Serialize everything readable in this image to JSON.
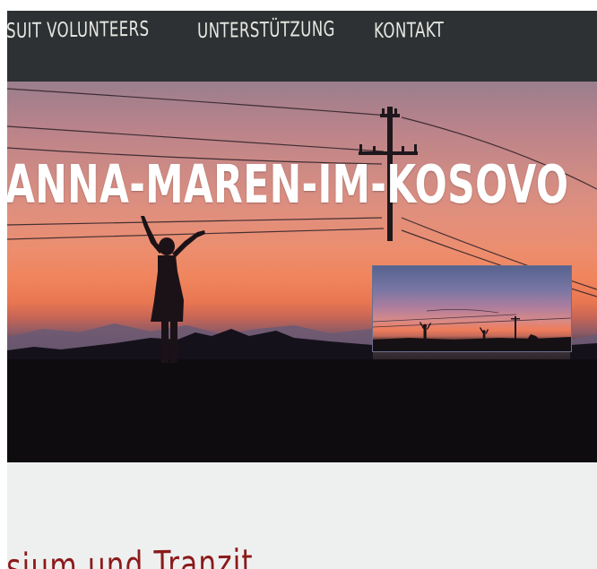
{
  "nav": {
    "items": [
      {
        "label": "SUIT VOLUNTEERS"
      },
      {
        "label": "UNTERSTÜTZUNG"
      },
      {
        "label": "KONTAKT"
      }
    ]
  },
  "hero": {
    "title": "ANNA-MAREN-IM-KOSOVO"
  },
  "post": {
    "title": "sium und Tranzit"
  },
  "colors": {
    "nav_background": "#2d3133",
    "nav_text": "#e7e7e2",
    "hero_title": "#ffffff",
    "post_title": "#8c1a1a",
    "page_background": "#eef0f0"
  }
}
